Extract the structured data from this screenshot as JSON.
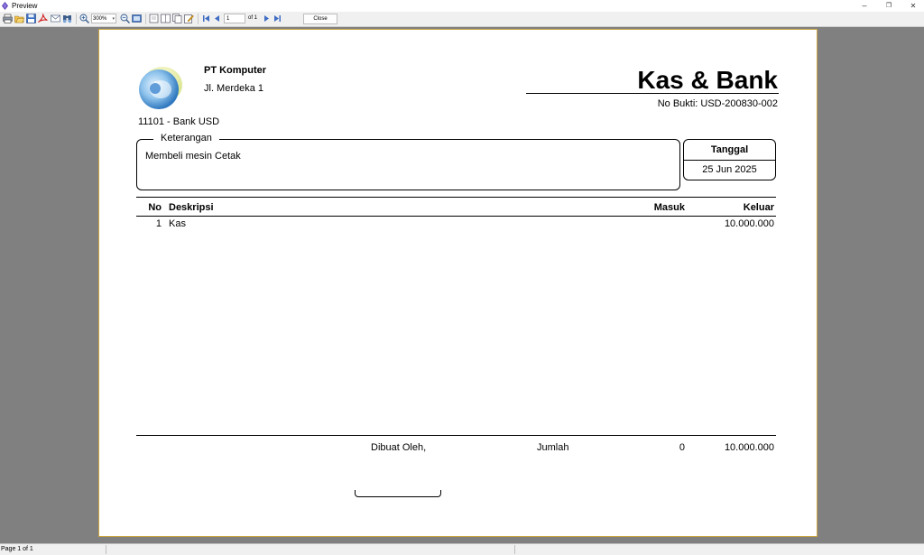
{
  "window": {
    "title": "Preview",
    "minimize_glyph": "–",
    "restore_glyph": "❐",
    "close_glyph": "✕"
  },
  "toolbar": {
    "zoom_value": "300%",
    "page_number": "1",
    "page_of": "of 1",
    "close_label": "Close",
    "icons": [
      "print-icon",
      "open-icon",
      "save-icon",
      "pdf-icon",
      "email-icon",
      "find-icon",
      "zoom-in-icon",
      "zoom-out-icon",
      "fit-page-icon",
      "single-page-icon",
      "two-page-icon",
      "multi-page-icon",
      "edit-page-icon",
      "first-page-icon",
      "prev-page-icon",
      "next-page-icon",
      "last-page-icon"
    ]
  },
  "document": {
    "company_name": "PT Komputer",
    "company_address": "Jl. Merdeka 1",
    "title": "Kas & Bank",
    "no_bukti": "No Bukti: USD-200830-002",
    "account": "11101 - Bank USD",
    "keterangan_label": "Keterangan",
    "keterangan_text": "Membeli mesin Cetak",
    "tanggal_label": "Tanggal",
    "tanggal_value": "25 Jun 2025",
    "table": {
      "headers": {
        "no": "No",
        "deskripsi": "Deskripsi",
        "masuk": "Masuk",
        "keluar": "Keluar"
      },
      "rows": [
        {
          "no": "1",
          "deskripsi": "Kas",
          "masuk": "",
          "keluar": "10.000.000"
        }
      ]
    },
    "footer": {
      "dibuat_oleh": "Dibuat Oleh,",
      "jumlah_label": "Jumlah",
      "total_masuk": "0",
      "total_keluar": "10.000.000"
    }
  },
  "statusbar": {
    "page_info": "Page 1 of 1"
  }
}
